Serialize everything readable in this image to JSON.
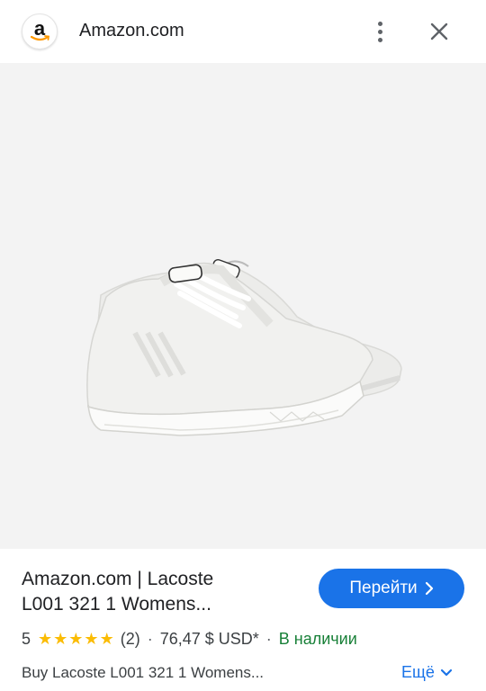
{
  "header": {
    "logo_letter": "a",
    "site_name": "Amazon.com"
  },
  "product": {
    "title_line1": "Amazon.com | Lacoste",
    "title_line2": "L001 321 1 Womens...",
    "visit_label": "Перейти",
    "rating_value": "5",
    "stars": "★★★★★",
    "review_count": "(2)",
    "separator": "·",
    "price": "76,47 $ USD*",
    "availability": "В наличии",
    "description": "Buy Lacoste L001 321 1 Womens...",
    "more_label": "Ещё"
  },
  "colors": {
    "accent": "#1a73e8",
    "stars": "#fbbc04",
    "in_stock": "#188038",
    "image_bg": "#f3f3f3"
  },
  "icons": [
    "amazon-logo-icon",
    "more-vert-icon",
    "close-icon",
    "google-lens-icon",
    "chevron-right-icon",
    "chevron-down-icon"
  ]
}
